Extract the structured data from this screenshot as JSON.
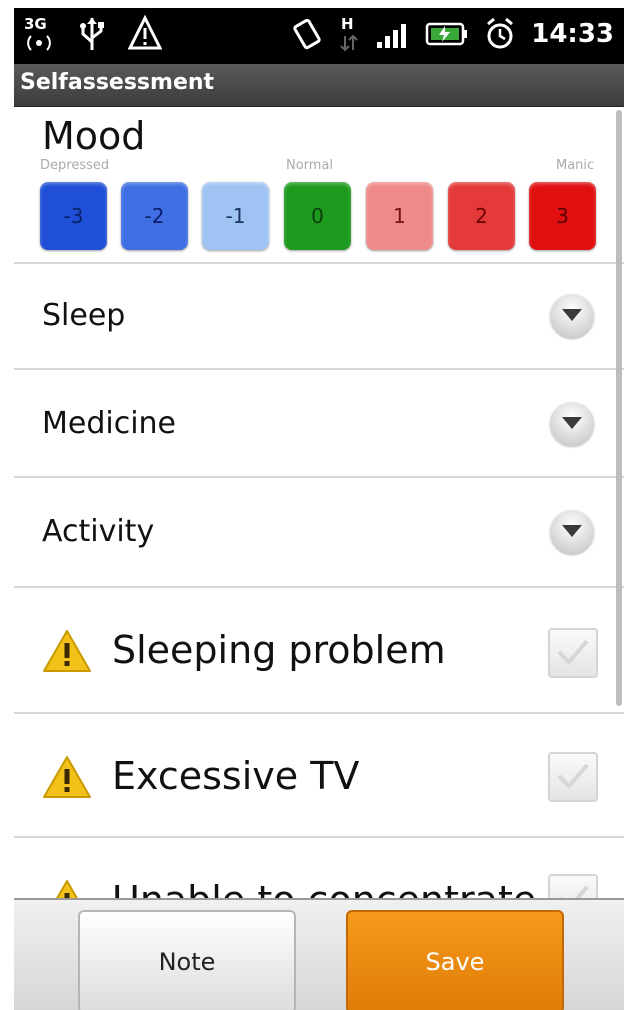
{
  "status_bar": {
    "network_label": "3G",
    "data_label": "H",
    "time": "14:33"
  },
  "app": {
    "title": "Selfassessment"
  },
  "mood": {
    "title": "Mood",
    "scale_labels": {
      "low": "Depressed",
      "mid": "Normal",
      "high": "Manic"
    },
    "options": [
      {
        "value": "-3",
        "color": "#1f4fd6",
        "text_color": "#0b1f6b"
      },
      {
        "value": "-2",
        "color": "#3f6fe2",
        "text_color": "#0b1f6b"
      },
      {
        "value": "-1",
        "color": "#9fc3f2",
        "text_color": "#1b3560"
      },
      {
        "value": "0",
        "color": "#1e9a1e",
        "text_color": "#0a3d0a"
      },
      {
        "value": "1",
        "color": "#ef8a8a",
        "text_color": "#7a1010"
      },
      {
        "value": "2",
        "color": "#e43a3a",
        "text_color": "#6a0000"
      },
      {
        "value": "3",
        "color": "#e01010",
        "text_color": "#5a0000"
      }
    ]
  },
  "expandable_items": [
    {
      "label": "Sleep",
      "icon": "chevron-down-icon"
    },
    {
      "label": "Medicine",
      "icon": "chevron-down-icon"
    },
    {
      "label": "Activity",
      "icon": "chevron-down-icon"
    }
  ],
  "warning_items": [
    {
      "label": "Sleeping problem",
      "icon": "warning-icon",
      "checked": false
    },
    {
      "label": "Excessive TV",
      "icon": "warning-icon",
      "checked": false
    },
    {
      "label": "Unable to concentrate",
      "icon": "warning-icon",
      "checked": false
    }
  ],
  "buttons": {
    "note": "Note",
    "save": "Save"
  },
  "colors": {
    "save_accent": "#e88a0c",
    "warning": "#f2c21a"
  }
}
